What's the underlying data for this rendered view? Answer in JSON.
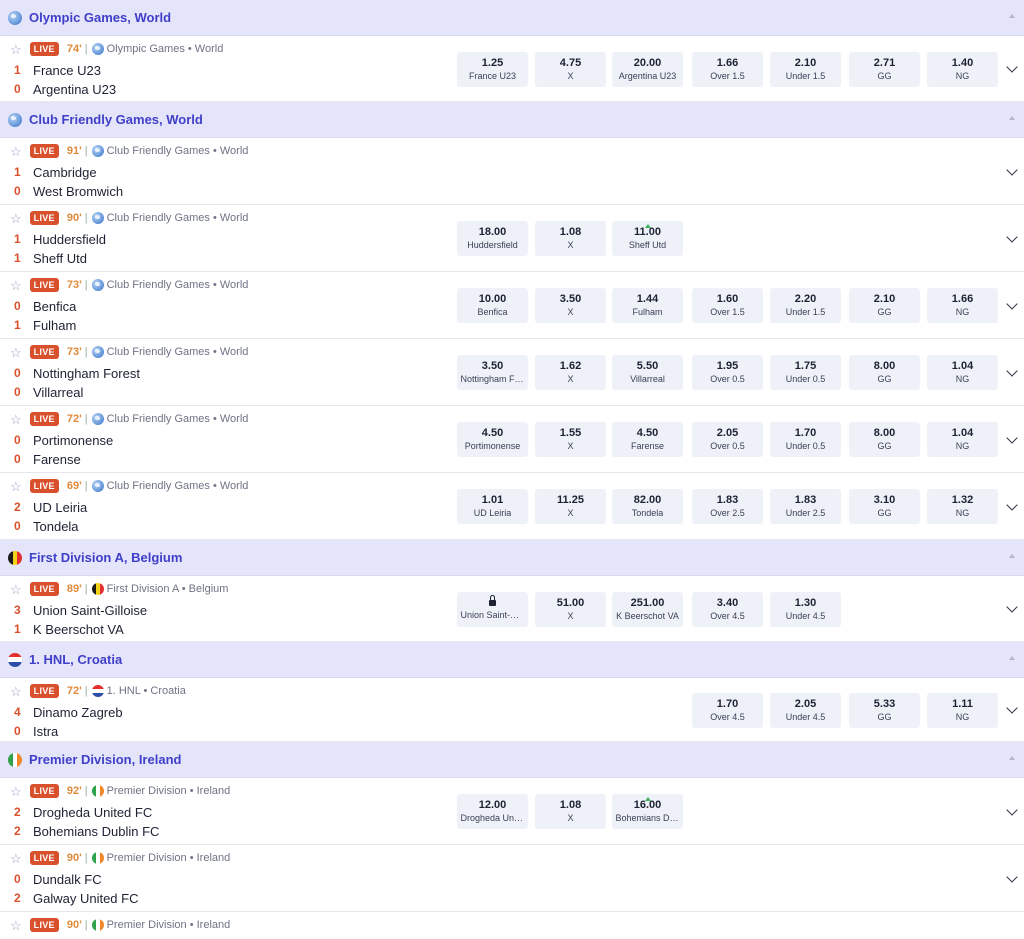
{
  "leagues": [
    {
      "title": "Olympic Games, World",
      "flag": "globe-icon"
    },
    {
      "title": "Club Friendly Games, World",
      "flag": "globe-icon"
    },
    {
      "title": "First Division A, Belgium",
      "flag": "belgium-flag-icon"
    },
    {
      "title": "1. HNL, Croatia",
      "flag": "croatia-flag-icon"
    },
    {
      "title": "Premier Division, Ireland",
      "flag": "ireland-flag-icon"
    }
  ],
  "live_label": "LIVE",
  "separator": "|",
  "matches": [
    {
      "minute": "74'",
      "competition": "Olympic Games • World",
      "home": {
        "score": "1",
        "name": "France U23"
      },
      "away": {
        "score": "0",
        "name": "Argentina U23"
      },
      "odds": [
        {
          "value": "1.25",
          "label": "France U23"
        },
        {
          "value": "4.75",
          "label": "X"
        },
        {
          "value": "20.00",
          "label": "Argentina U23"
        },
        {
          "value": "1.66",
          "label": "Over 1.5"
        },
        {
          "value": "2.10",
          "label": "Under 1.5"
        },
        {
          "value": "2.71",
          "label": "GG"
        },
        {
          "value": "1.40",
          "label": "NG"
        }
      ]
    },
    {
      "minute": "91'",
      "competition": "Club Friendly Games • World",
      "home": {
        "score": "1",
        "name": "Cambridge"
      },
      "away": {
        "score": "0",
        "name": "West Bromwich"
      },
      "odds": []
    },
    {
      "minute": "90'",
      "competition": "Club Friendly Games • World",
      "home": {
        "score": "1",
        "name": "Huddersfield"
      },
      "away": {
        "score": "1",
        "name": "Sheff Utd"
      },
      "odds": [
        {
          "value": "18.00",
          "label": "Huddersfield"
        },
        {
          "value": "1.08",
          "label": "X"
        },
        {
          "value": "11.00",
          "label": "Sheff Utd",
          "trend": "up"
        }
      ]
    },
    {
      "minute": "73'",
      "competition": "Club Friendly Games • World",
      "home": {
        "score": "0",
        "name": "Benfica"
      },
      "away": {
        "score": "1",
        "name": "Fulham"
      },
      "odds": [
        {
          "value": "10.00",
          "label": "Benfica"
        },
        {
          "value": "3.50",
          "label": "X"
        },
        {
          "value": "1.44",
          "label": "Fulham"
        },
        {
          "value": "1.60",
          "label": "Over 1.5"
        },
        {
          "value": "2.20",
          "label": "Under 1.5"
        },
        {
          "value": "2.10",
          "label": "GG"
        },
        {
          "value": "1.66",
          "label": "NG"
        }
      ]
    },
    {
      "minute": "73'",
      "competition": "Club Friendly Games • World",
      "home": {
        "score": "0",
        "name": "Nottingham Forest"
      },
      "away": {
        "score": "0",
        "name": "Villarreal"
      },
      "odds": [
        {
          "value": "3.50",
          "label": "Nottingham Forest"
        },
        {
          "value": "1.62",
          "label": "X"
        },
        {
          "value": "5.50",
          "label": "Villarreal"
        },
        {
          "value": "1.95",
          "label": "Over 0.5"
        },
        {
          "value": "1.75",
          "label": "Under 0.5"
        },
        {
          "value": "8.00",
          "label": "GG"
        },
        {
          "value": "1.04",
          "label": "NG"
        }
      ]
    },
    {
      "minute": "72'",
      "competition": "Club Friendly Games • World",
      "home": {
        "score": "0",
        "name": "Portimonense"
      },
      "away": {
        "score": "0",
        "name": "Farense"
      },
      "odds": [
        {
          "value": "4.50",
          "label": "Portimonense"
        },
        {
          "value": "1.55",
          "label": "X"
        },
        {
          "value": "4.50",
          "label": "Farense"
        },
        {
          "value": "2.05",
          "label": "Over 0.5"
        },
        {
          "value": "1.70",
          "label": "Under 0.5"
        },
        {
          "value": "8.00",
          "label": "GG"
        },
        {
          "value": "1.04",
          "label": "NG"
        }
      ]
    },
    {
      "minute": "69'",
      "competition": "Club Friendly Games • World",
      "home": {
        "score": "2",
        "name": "UD Leiria"
      },
      "away": {
        "score": "0",
        "name": "Tondela"
      },
      "odds": [
        {
          "value": "1.01",
          "label": "UD Leiria"
        },
        {
          "value": "11.25",
          "label": "X"
        },
        {
          "value": "82.00",
          "label": "Tondela"
        },
        {
          "value": "1.83",
          "label": "Over 2.5"
        },
        {
          "value": "1.83",
          "label": "Under 2.5"
        },
        {
          "value": "3.10",
          "label": "GG"
        },
        {
          "value": "1.32",
          "label": "NG"
        }
      ]
    },
    {
      "minute": "89'",
      "competition": "First Division A • Belgium",
      "home": {
        "score": "3",
        "name": "Union Saint-Gilloise"
      },
      "away": {
        "score": "1",
        "name": "K Beerschot VA"
      },
      "odds": [
        {
          "value": "",
          "label": "Union Saint-Gilloise",
          "locked": true
        },
        {
          "value": "51.00",
          "label": "X"
        },
        {
          "value": "251.00",
          "label": "K Beerschot VA"
        },
        {
          "value": "3.40",
          "label": "Over 4.5"
        },
        {
          "value": "1.30",
          "label": "Under 4.5"
        }
      ]
    },
    {
      "minute": "72'",
      "competition": "1. HNL • Croatia",
      "home": {
        "score": "4",
        "name": "Dinamo Zagreb"
      },
      "away": {
        "score": "0",
        "name": "Istra"
      },
      "odds": [
        {
          "value": "1.70",
          "label": "Over 4.5"
        },
        {
          "value": "2.05",
          "label": "Under 4.5"
        },
        {
          "value": "5.33",
          "label": "GG"
        },
        {
          "value": "1.11",
          "label": "NG"
        }
      ]
    },
    {
      "minute": "92'",
      "competition": "Premier Division • Ireland",
      "home": {
        "score": "2",
        "name": "Drogheda United FC"
      },
      "away": {
        "score": "2",
        "name": "Bohemians Dublin FC"
      },
      "odds": [
        {
          "value": "12.00",
          "label": "Drogheda United FC"
        },
        {
          "value": "1.08",
          "label": "X"
        },
        {
          "value": "16.00",
          "label": "Bohemians Dublin FC",
          "trend": "up"
        }
      ]
    },
    {
      "minute": "90'",
      "competition": "Premier Division • Ireland",
      "home": {
        "score": "0",
        "name": "Dundalk FC"
      },
      "away": {
        "score": "2",
        "name": "Galway United FC"
      },
      "odds": []
    },
    {
      "minute": "90'",
      "competition": "Premier Division • Ireland",
      "home": {
        "score": "",
        "name": ""
      },
      "away": {
        "score": "",
        "name": ""
      },
      "odds": []
    }
  ],
  "colors": {
    "accent": "#3f3fc9",
    "header_bg": "#e4e4fb",
    "live": "#d9512c",
    "minute": "#e08a3a",
    "odds_bg": "#eef1f8",
    "trend_up": "#3bb35a"
  }
}
